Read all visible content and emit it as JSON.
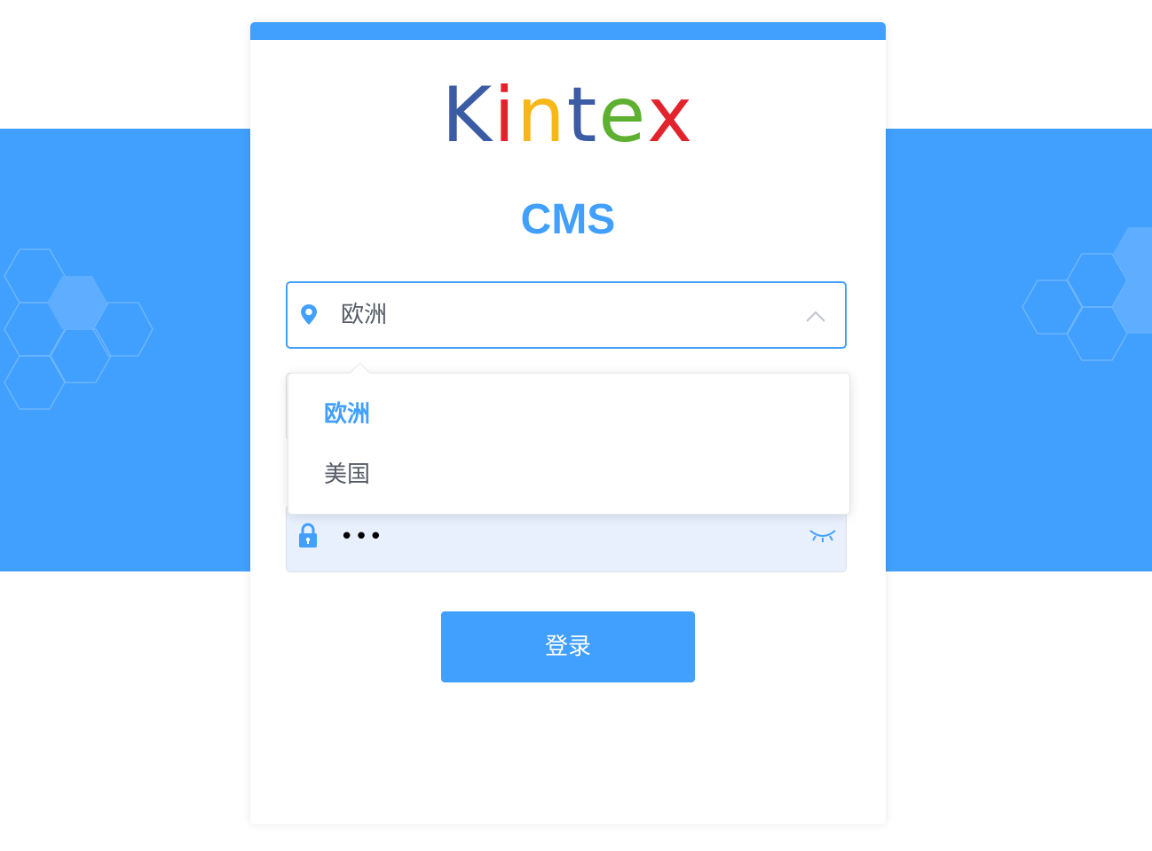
{
  "brand": {
    "logo_letters": [
      {
        "char": "K",
        "color": "#3b5ba5"
      },
      {
        "char": "i",
        "color": "#e3232c"
      },
      {
        "char": "n",
        "color": "#f7b717"
      },
      {
        "char": "t",
        "color": "#3b5ba5"
      },
      {
        "char": "e",
        "color": "#5db030"
      },
      {
        "char": "x",
        "color": "#e3232c"
      }
    ],
    "title": "CMS"
  },
  "form": {
    "region": {
      "value": "欧洲",
      "icon": "location-pin-icon",
      "toggle_icon": "chevron-up-icon",
      "expanded": true,
      "options": [
        {
          "label": "欧洲",
          "selected": true
        },
        {
          "label": "美国",
          "selected": false
        }
      ]
    },
    "password": {
      "value": "•••",
      "icon": "lock-icon",
      "toggle_icon": "eye-closed-icon"
    },
    "login_button_label": "登录"
  },
  "colors": {
    "primary": "#419ffe",
    "text": "#555b66",
    "autofill_bg": "#e8f0fe"
  }
}
